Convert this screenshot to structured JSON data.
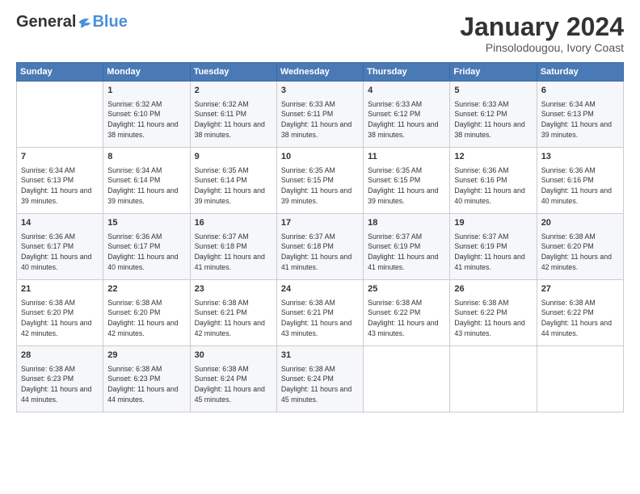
{
  "logo": {
    "general": "General",
    "blue": "Blue"
  },
  "header": {
    "title": "January 2024",
    "subtitle": "Pinsolodougou, Ivory Coast"
  },
  "calendar": {
    "days": [
      "Sunday",
      "Monday",
      "Tuesday",
      "Wednesday",
      "Thursday",
      "Friday",
      "Saturday"
    ],
    "weeks": [
      [
        {
          "date": "",
          "sunrise": "",
          "sunset": "",
          "daylight": ""
        },
        {
          "date": "1",
          "sunrise": "Sunrise: 6:32 AM",
          "sunset": "Sunset: 6:10 PM",
          "daylight": "Daylight: 11 hours and 38 minutes."
        },
        {
          "date": "2",
          "sunrise": "Sunrise: 6:32 AM",
          "sunset": "Sunset: 6:11 PM",
          "daylight": "Daylight: 11 hours and 38 minutes."
        },
        {
          "date": "3",
          "sunrise": "Sunrise: 6:33 AM",
          "sunset": "Sunset: 6:11 PM",
          "daylight": "Daylight: 11 hours and 38 minutes."
        },
        {
          "date": "4",
          "sunrise": "Sunrise: 6:33 AM",
          "sunset": "Sunset: 6:12 PM",
          "daylight": "Daylight: 11 hours and 38 minutes."
        },
        {
          "date": "5",
          "sunrise": "Sunrise: 6:33 AM",
          "sunset": "Sunset: 6:12 PM",
          "daylight": "Daylight: 11 hours and 38 minutes."
        },
        {
          "date": "6",
          "sunrise": "Sunrise: 6:34 AM",
          "sunset": "Sunset: 6:13 PM",
          "daylight": "Daylight: 11 hours and 39 minutes."
        }
      ],
      [
        {
          "date": "7",
          "sunrise": "Sunrise: 6:34 AM",
          "sunset": "Sunset: 6:13 PM",
          "daylight": "Daylight: 11 hours and 39 minutes."
        },
        {
          "date": "8",
          "sunrise": "Sunrise: 6:34 AM",
          "sunset": "Sunset: 6:14 PM",
          "daylight": "Daylight: 11 hours and 39 minutes."
        },
        {
          "date": "9",
          "sunrise": "Sunrise: 6:35 AM",
          "sunset": "Sunset: 6:14 PM",
          "daylight": "Daylight: 11 hours and 39 minutes."
        },
        {
          "date": "10",
          "sunrise": "Sunrise: 6:35 AM",
          "sunset": "Sunset: 6:15 PM",
          "daylight": "Daylight: 11 hours and 39 minutes."
        },
        {
          "date": "11",
          "sunrise": "Sunrise: 6:35 AM",
          "sunset": "Sunset: 6:15 PM",
          "daylight": "Daylight: 11 hours and 39 minutes."
        },
        {
          "date": "12",
          "sunrise": "Sunrise: 6:36 AM",
          "sunset": "Sunset: 6:16 PM",
          "daylight": "Daylight: 11 hours and 40 minutes."
        },
        {
          "date": "13",
          "sunrise": "Sunrise: 6:36 AM",
          "sunset": "Sunset: 6:16 PM",
          "daylight": "Daylight: 11 hours and 40 minutes."
        }
      ],
      [
        {
          "date": "14",
          "sunrise": "Sunrise: 6:36 AM",
          "sunset": "Sunset: 6:17 PM",
          "daylight": "Daylight: 11 hours and 40 minutes."
        },
        {
          "date": "15",
          "sunrise": "Sunrise: 6:36 AM",
          "sunset": "Sunset: 6:17 PM",
          "daylight": "Daylight: 11 hours and 40 minutes."
        },
        {
          "date": "16",
          "sunrise": "Sunrise: 6:37 AM",
          "sunset": "Sunset: 6:18 PM",
          "daylight": "Daylight: 11 hours and 41 minutes."
        },
        {
          "date": "17",
          "sunrise": "Sunrise: 6:37 AM",
          "sunset": "Sunset: 6:18 PM",
          "daylight": "Daylight: 11 hours and 41 minutes."
        },
        {
          "date": "18",
          "sunrise": "Sunrise: 6:37 AM",
          "sunset": "Sunset: 6:19 PM",
          "daylight": "Daylight: 11 hours and 41 minutes."
        },
        {
          "date": "19",
          "sunrise": "Sunrise: 6:37 AM",
          "sunset": "Sunset: 6:19 PM",
          "daylight": "Daylight: 11 hours and 41 minutes."
        },
        {
          "date": "20",
          "sunrise": "Sunrise: 6:38 AM",
          "sunset": "Sunset: 6:20 PM",
          "daylight": "Daylight: 11 hours and 42 minutes."
        }
      ],
      [
        {
          "date": "21",
          "sunrise": "Sunrise: 6:38 AM",
          "sunset": "Sunset: 6:20 PM",
          "daylight": "Daylight: 11 hours and 42 minutes."
        },
        {
          "date": "22",
          "sunrise": "Sunrise: 6:38 AM",
          "sunset": "Sunset: 6:20 PM",
          "daylight": "Daylight: 11 hours and 42 minutes."
        },
        {
          "date": "23",
          "sunrise": "Sunrise: 6:38 AM",
          "sunset": "Sunset: 6:21 PM",
          "daylight": "Daylight: 11 hours and 42 minutes."
        },
        {
          "date": "24",
          "sunrise": "Sunrise: 6:38 AM",
          "sunset": "Sunset: 6:21 PM",
          "daylight": "Daylight: 11 hours and 43 minutes."
        },
        {
          "date": "25",
          "sunrise": "Sunrise: 6:38 AM",
          "sunset": "Sunset: 6:22 PM",
          "daylight": "Daylight: 11 hours and 43 minutes."
        },
        {
          "date": "26",
          "sunrise": "Sunrise: 6:38 AM",
          "sunset": "Sunset: 6:22 PM",
          "daylight": "Daylight: 11 hours and 43 minutes."
        },
        {
          "date": "27",
          "sunrise": "Sunrise: 6:38 AM",
          "sunset": "Sunset: 6:22 PM",
          "daylight": "Daylight: 11 hours and 44 minutes."
        }
      ],
      [
        {
          "date": "28",
          "sunrise": "Sunrise: 6:38 AM",
          "sunset": "Sunset: 6:23 PM",
          "daylight": "Daylight: 11 hours and 44 minutes."
        },
        {
          "date": "29",
          "sunrise": "Sunrise: 6:38 AM",
          "sunset": "Sunset: 6:23 PM",
          "daylight": "Daylight: 11 hours and 44 minutes."
        },
        {
          "date": "30",
          "sunrise": "Sunrise: 6:38 AM",
          "sunset": "Sunset: 6:24 PM",
          "daylight": "Daylight: 11 hours and 45 minutes."
        },
        {
          "date": "31",
          "sunrise": "Sunrise: 6:38 AM",
          "sunset": "Sunset: 6:24 PM",
          "daylight": "Daylight: 11 hours and 45 minutes."
        },
        {
          "date": "",
          "sunrise": "",
          "sunset": "",
          "daylight": ""
        },
        {
          "date": "",
          "sunrise": "",
          "sunset": "",
          "daylight": ""
        },
        {
          "date": "",
          "sunrise": "",
          "sunset": "",
          "daylight": ""
        }
      ]
    ]
  }
}
